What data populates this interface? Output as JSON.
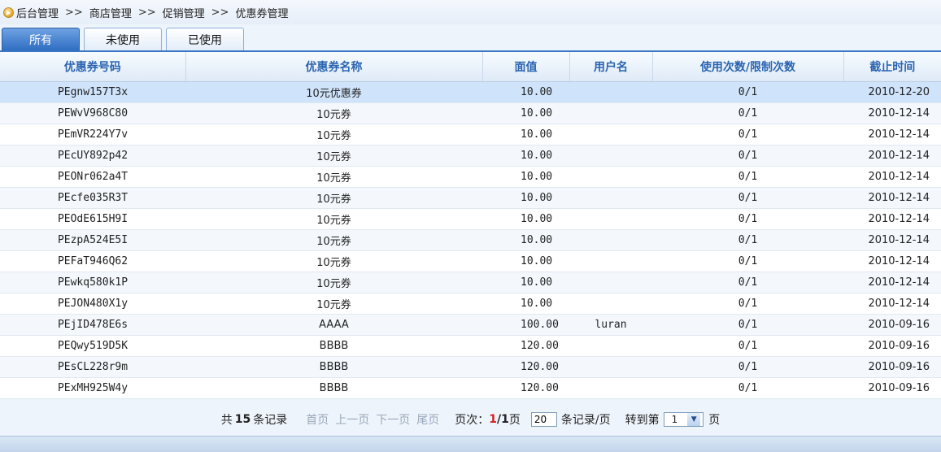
{
  "breadcrumb": {
    "items": [
      "后台管理",
      "商店管理",
      "促销管理",
      "优惠券管理"
    ],
    "separator": ">>"
  },
  "tabs": [
    {
      "label": "所有",
      "active": true
    },
    {
      "label": "未使用",
      "active": false
    },
    {
      "label": "已使用",
      "active": false
    }
  ],
  "table": {
    "columns": [
      "优惠券号码",
      "优惠券名称",
      "面值",
      "用户名",
      "使用次数/限制次数",
      "截止时间"
    ],
    "rows": [
      {
        "code": "PEgnw157T3x",
        "name": "10元优惠券",
        "value": "10.00",
        "user": "",
        "usage": "0/1",
        "expiry": "2010-12-20"
      },
      {
        "code": "PEWvV968C80",
        "name": "10元券",
        "value": "10.00",
        "user": "",
        "usage": "0/1",
        "expiry": "2010-12-14"
      },
      {
        "code": "PEmVR224Y7v",
        "name": "10元券",
        "value": "10.00",
        "user": "",
        "usage": "0/1",
        "expiry": "2010-12-14"
      },
      {
        "code": "PEcUY892p42",
        "name": "10元券",
        "value": "10.00",
        "user": "",
        "usage": "0/1",
        "expiry": "2010-12-14"
      },
      {
        "code": "PEONr062a4T",
        "name": "10元券",
        "value": "10.00",
        "user": "",
        "usage": "0/1",
        "expiry": "2010-12-14"
      },
      {
        "code": "PEcfe035R3T",
        "name": "10元券",
        "value": "10.00",
        "user": "",
        "usage": "0/1",
        "expiry": "2010-12-14"
      },
      {
        "code": "PEOdE615H9I",
        "name": "10元券",
        "value": "10.00",
        "user": "",
        "usage": "0/1",
        "expiry": "2010-12-14"
      },
      {
        "code": "PEzpA524E5I",
        "name": "10元券",
        "value": "10.00",
        "user": "",
        "usage": "0/1",
        "expiry": "2010-12-14"
      },
      {
        "code": "PEFaT946Q62",
        "name": "10元券",
        "value": "10.00",
        "user": "",
        "usage": "0/1",
        "expiry": "2010-12-14"
      },
      {
        "code": "PEwkq580k1P",
        "name": "10元券",
        "value": "10.00",
        "user": "",
        "usage": "0/1",
        "expiry": "2010-12-14"
      },
      {
        "code": "PEJON480X1y",
        "name": "10元券",
        "value": "10.00",
        "user": "",
        "usage": "0/1",
        "expiry": "2010-12-14"
      },
      {
        "code": "PEjID478E6s",
        "name": "AAAA",
        "value": "100.00",
        "user": "luran",
        "usage": "0/1",
        "expiry": "2010-09-16"
      },
      {
        "code": "PEQwy519D5K",
        "name": "BBBB",
        "value": "120.00",
        "user": "",
        "usage": "0/1",
        "expiry": "2010-09-16"
      },
      {
        "code": "PEsCL228r9m",
        "name": "BBBB",
        "value": "120.00",
        "user": "",
        "usage": "0/1",
        "expiry": "2010-09-16"
      },
      {
        "code": "PExMH925W4y",
        "name": "BBBB",
        "value": "120.00",
        "user": "",
        "usage": "0/1",
        "expiry": "2010-09-16"
      }
    ]
  },
  "pager": {
    "total_prefix": "共",
    "total_count": "15",
    "total_suffix": "条记录",
    "first": "首页",
    "prev": "上一页",
    "next": "下一页",
    "last": "尾页",
    "page_label": "页次：",
    "current_page": "1",
    "total_pages": "1",
    "page_suffix": "页",
    "per_page_value": "20",
    "per_page_suffix": "条记录/页",
    "goto_label": "转到第",
    "goto_value": "1",
    "goto_suffix": "页"
  },
  "colors": {
    "header_text": "#2a64b0",
    "tab_active": "#2f6ec2",
    "selected_row": "#cfe3fb",
    "current_page": "#d42020"
  }
}
